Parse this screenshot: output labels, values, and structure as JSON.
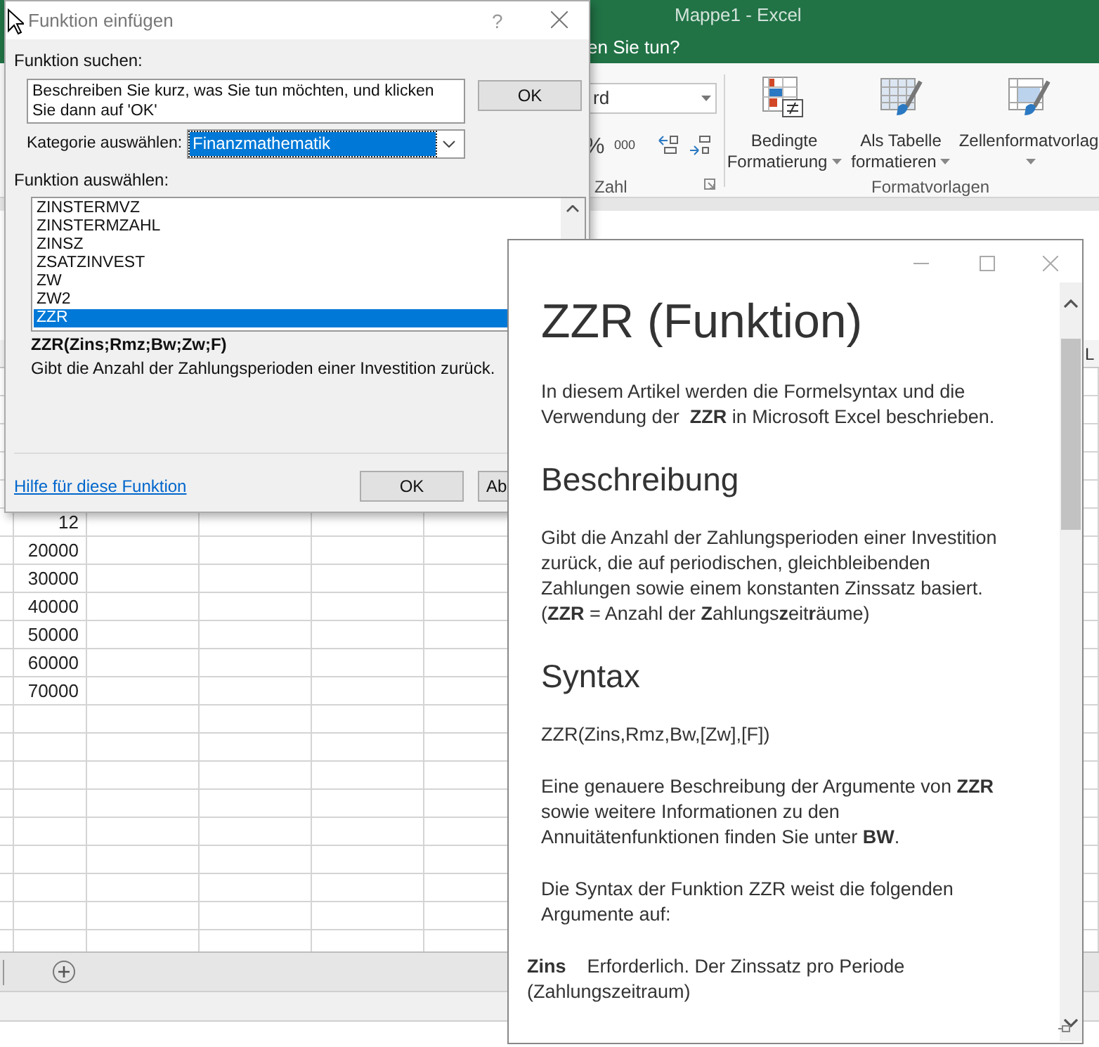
{
  "excel": {
    "title": "Mappe1 - Excel",
    "tell_me": "en Sie tun?",
    "ribbon": {
      "number_format": "rd",
      "percent": "%",
      "thousands": "000",
      "number_group": "Zahl",
      "styles": [
        {
          "kind": "conditional",
          "label": "Bedingte\nFormatierung"
        },
        {
          "kind": "table",
          "label": "Als Tabelle\nformatieren"
        },
        {
          "kind": "cell",
          "label": "Zellenformatvorlag"
        }
      ],
      "styles_group": "Formatvorlagen"
    },
    "column_header": "L",
    "cells": [
      "12",
      "20000",
      "30000",
      "40000",
      "50000",
      "60000",
      "70000"
    ]
  },
  "dialog": {
    "title": "Funktion einfügen",
    "help_button": "?",
    "search": {
      "label": "Funktion suchen:",
      "value": "Beschreiben Sie kurz, was Sie tun möchten, und klicken Sie dann auf 'OK'"
    },
    "go_button": "OK",
    "category": {
      "label": "Kategorie auswählen:",
      "value": "Finanzmathematik"
    },
    "list_label": "Funktion auswählen:",
    "functions": [
      {
        "name": "ZINSTERMVZ",
        "selected": false
      },
      {
        "name": "ZINSTERMZAHL",
        "selected": false
      },
      {
        "name": "ZINSZ",
        "selected": false
      },
      {
        "name": "ZSATZINVEST",
        "selected": false
      },
      {
        "name": "ZW",
        "selected": false
      },
      {
        "name": "ZW2",
        "selected": false
      },
      {
        "name": "ZZR",
        "selected": true
      }
    ],
    "signature": "ZZR(Zins;Rmz;Bw;Zw;F)",
    "description": "Gibt die Anzahl der Zahlungsperioden einer Investition zurück.",
    "help_link": "Hilfe für diese Funktion",
    "ok_button": "OK",
    "cancel_button": "Ab"
  },
  "help_pane": {
    "title": "ZZR (Funktion)",
    "blocks": [
      {
        "kind": "paragraph",
        "text": "In diesem Artikel werden die Formelsyntax und die\nVerwendung der  **ZZR** in Microsoft Excel beschrieben."
      },
      {
        "kind": "heading",
        "text": "Beschreibung"
      },
      {
        "kind": "paragraph",
        "text": "Gibt die Anzahl der Zahlungsperioden einer Investition\nzurück, die auf periodischen, gleichbleibenden\nZahlungen sowie einem konstanten Zinssatz basiert.\n(**ZZR** = Anzahl der **Z**ahlungs**z**eit**r**äume)"
      },
      {
        "kind": "heading",
        "text": "Syntax"
      },
      {
        "kind": "paragraph",
        "text": "ZZR(Zins,Rmz,Bw,[Zw],[F])"
      },
      {
        "kind": "paragraph",
        "text": "Eine genauere Beschreibung der Argumente von **ZZR**\nsowie weitere Informationen zu den\nAnnuitätenfunktionen finden Sie unter **BW**."
      },
      {
        "kind": "paragraph",
        "text": "Die Syntax der Funktion ZZR weist die folgenden\nArgumente auf:"
      },
      {
        "kind": "argument",
        "text": "**Zins**    Erforderlich. Der Zinssatz pro Periode\n(Zahlungszeitraum)"
      }
    ]
  }
}
